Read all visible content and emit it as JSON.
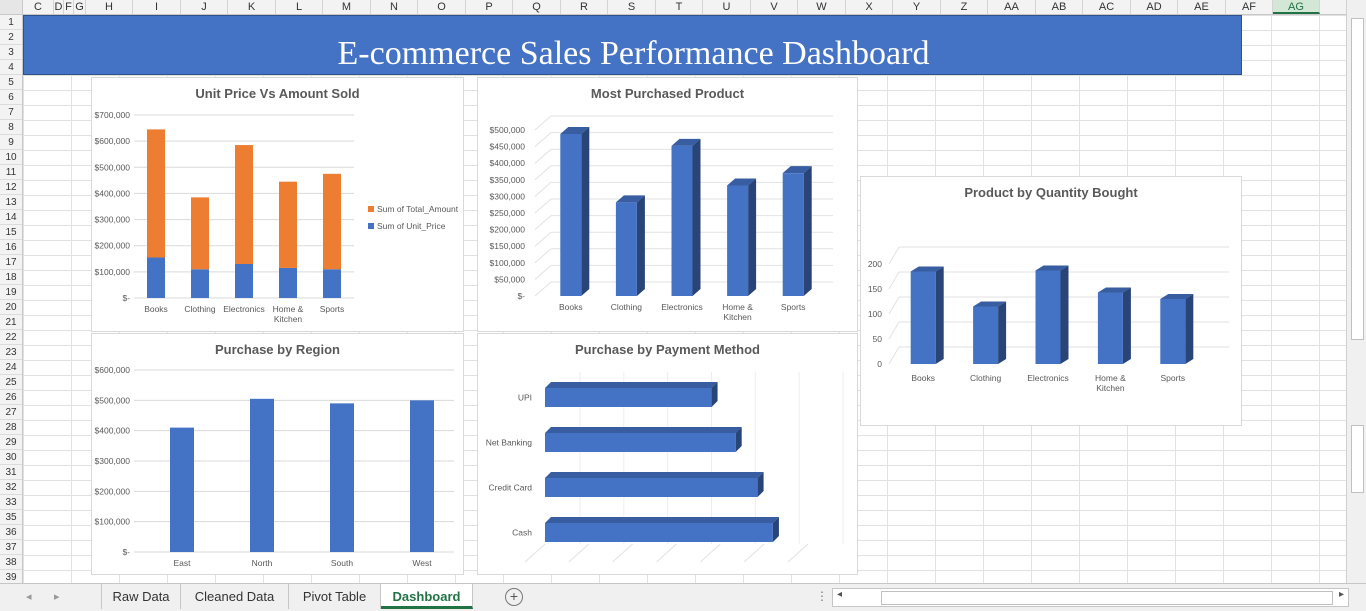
{
  "columns": [
    "C",
    "D",
    "F",
    "G",
    "H",
    "I",
    "J",
    "K",
    "L",
    "M",
    "N",
    "O",
    "P",
    "Q",
    "R",
    "S",
    "T",
    "U",
    "V",
    "W",
    "X",
    "Y",
    "Z",
    "AA",
    "AB",
    "AC",
    "AD",
    "AE",
    "AF",
    "AG"
  ],
  "rows": [
    "1",
    "2",
    "3",
    "4",
    "5",
    "6",
    "7",
    "8",
    "9",
    "10",
    "11",
    "12",
    "13",
    "14",
    "15",
    "16",
    "17",
    "18",
    "19",
    "20",
    "21",
    "22",
    "23",
    "24",
    "25",
    "26",
    "27",
    "28",
    "29",
    "30",
    "31",
    "32",
    "33",
    "35",
    "36",
    "37",
    "38",
    "39"
  ],
  "selected_column": "AG",
  "dashboard_title": "E-commerce Sales Performance Dashboard",
  "sheet_tabs": [
    "Raw Data",
    "Cleaned Data",
    "Pivot Table",
    "Dashboard"
  ],
  "active_tab": "Dashboard",
  "scroll_ellipsis": "⋮",
  "colors": {
    "banner": "#4472c4",
    "series_blue": "#4472c4",
    "series_orange": "#ed7d31",
    "active_tab": "#217346"
  },
  "chart_data": [
    {
      "id": "unit-price-vs-amount",
      "type": "bar",
      "stacked": true,
      "title": "Unit Price Vs Amount Sold",
      "categories": [
        "Books",
        "Clothing",
        "Electronics",
        "Home & Kitchen",
        "Sports"
      ],
      "series": [
        {
          "name": "Sum of Unit_Price",
          "values": [
            155000,
            110000,
            130000,
            115000,
            110000
          ]
        },
        {
          "name": "Sum of Total_Amount",
          "values": [
            490000,
            275000,
            455000,
            330000,
            365000
          ]
        }
      ],
      "yticks": [
        "$-",
        "$100,000",
        "$200,000",
        "$300,000",
        "$400,000",
        "$500,000",
        "$600,000",
        "$700,000"
      ],
      "ylim": [
        0,
        700000
      ],
      "legend": "right"
    },
    {
      "id": "most-purchased-product",
      "type": "bar",
      "title": "Most Purchased Product",
      "categories": [
        "Books",
        "Clothing",
        "Electronics",
        "Home & Kitchen",
        "Sports"
      ],
      "values": [
        488000,
        282000,
        452000,
        333000,
        370000
      ],
      "yticks": [
        "$-",
        "$50,000",
        "$100,000",
        "$150,000",
        "$200,000",
        "$250,000",
        "$300,000",
        "$350,000",
        "$400,000",
        "$450,000",
        "$500,000"
      ],
      "ylim": [
        0,
        500000
      ]
    },
    {
      "id": "product-by-quantity",
      "type": "bar",
      "title": "Product by Quantity Bought",
      "categories": [
        "Books",
        "Clothing",
        "Electronics",
        "Home & Kitchen",
        "Sports"
      ],
      "values": [
        185,
        115,
        187,
        143,
        130
      ],
      "yticks": [
        "0",
        "50",
        "100",
        "150",
        "200"
      ],
      "ylim": [
        0,
        200
      ]
    },
    {
      "id": "purchase-by-region",
      "type": "bar",
      "title": "Purchase by Region",
      "categories": [
        "East",
        "North",
        "South",
        "West"
      ],
      "values": [
        410000,
        505000,
        490000,
        500000
      ],
      "yticks": [
        "$-",
        "$100,000",
        "$200,000",
        "$300,000",
        "$400,000",
        "$500,000",
        "$600,000"
      ],
      "ylim": [
        0,
        600000
      ]
    },
    {
      "id": "purchase-by-payment",
      "type": "bar",
      "orientation": "horizontal",
      "title": "Purchase by Payment Method",
      "categories": [
        "UPI",
        "Net Banking",
        "Credit Card",
        "Cash"
      ],
      "values": [
        380000,
        435000,
        485000,
        520000
      ],
      "xlim": [
        0,
        600000
      ]
    }
  ]
}
